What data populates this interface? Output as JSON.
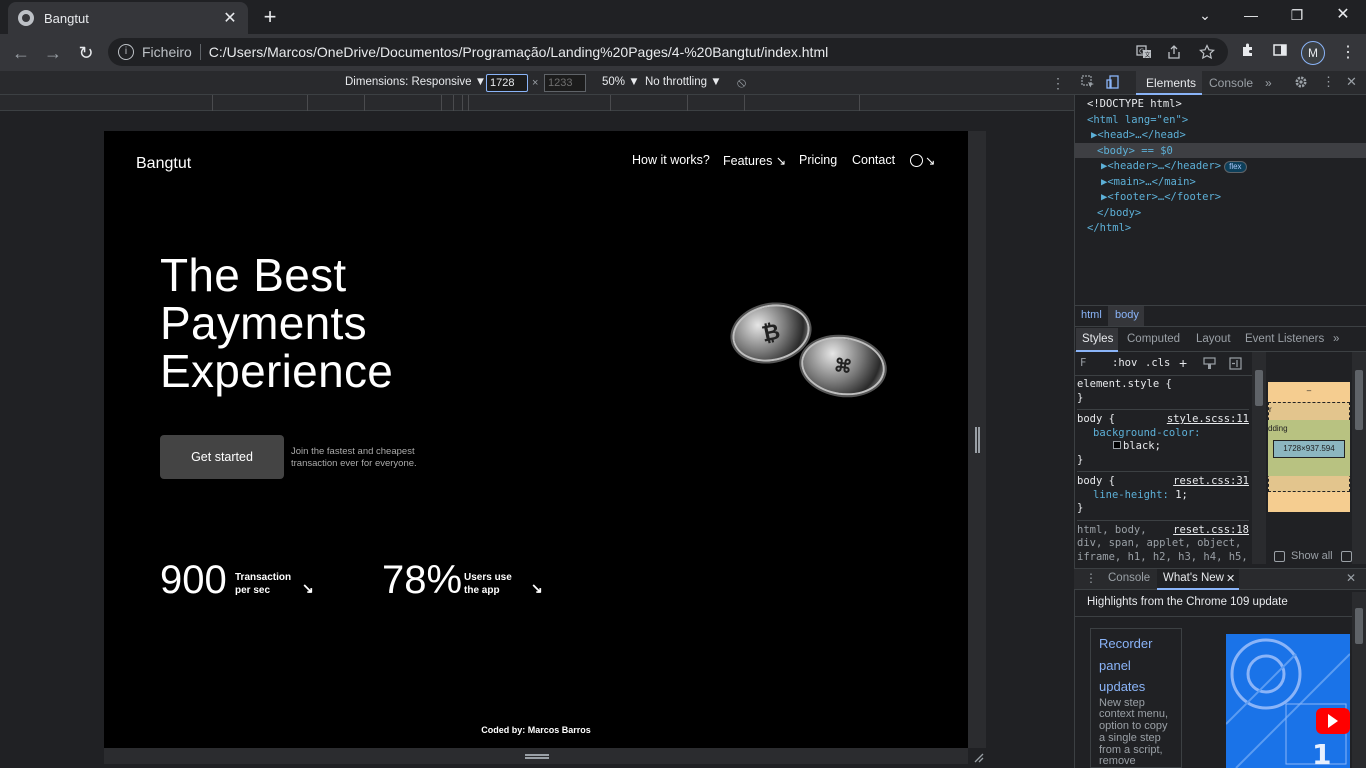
{
  "browser": {
    "tab_title": "Bangtut",
    "tab_close": "✕",
    "new_tab": "+",
    "window_controls": {
      "dropdown": "⌄",
      "minimize": "—",
      "restore": "❐",
      "close": "✕"
    },
    "nav": {
      "back": "←",
      "forward": "→",
      "reload": "↻"
    },
    "omnibox": {
      "info_icon": "i",
      "origin": "Ficheiro",
      "url": "C:/Users/Marcos/OneDrive/Documentos/Programação/Landing%20Pages/4-%20Bangtut/index.html"
    },
    "profile_initial": "M",
    "menu": "⋮"
  },
  "device_toolbar": {
    "dimensions_label": "Dimensions: Responsive ▼",
    "width": "1728",
    "times": "×",
    "height": "1233",
    "zoom": "50% ▼",
    "throttling": "No throttling ▼",
    "rotate_icon": "⦸",
    "more": "⋮"
  },
  "site": {
    "logo": "Bangtut",
    "nav": [
      "How it works?",
      "Features ↘",
      "Pricing",
      "Contact",
      "↘"
    ],
    "hero_lines": [
      "The Best",
      "Payments",
      "Experience"
    ],
    "cta_button": "Get started",
    "cta_text": "Join the fastest and cheapest transaction ever for everyone.",
    "stats": [
      {
        "number": "900",
        "label_1": "Transaction",
        "label_2": "per sec",
        "arrow": "↘"
      },
      {
        "number": "78%",
        "label_1": "Users use",
        "label_2": "the app",
        "arrow": "↘"
      }
    ],
    "coin_mark": "₿",
    "coin_mark_2": "⌘",
    "credit": "Coded by: Marcos Barros"
  },
  "devtools": {
    "tabs": [
      "Elements",
      "Console",
      "»"
    ],
    "dom": {
      "doctype": "<!DOCTYPE html>",
      "html_open": "<html lang=\"en\">",
      "head": "▶<head>…</head>",
      "body_open": "<body> == $0",
      "header": "▶<header>…</header>",
      "flex_badge": "flex",
      "main": "▶<main>…</main>",
      "footer": "▶<footer>…</footer>",
      "body_close": "</body>",
      "html_close": "</html>"
    },
    "breadcrumbs": [
      "html",
      "body"
    ],
    "styles_tabs": [
      "Styles",
      "Computed",
      "Layout",
      "Event Listeners",
      "»"
    ],
    "filter": {
      "placeholder": "F",
      "hov": ":hov",
      "cls": ".cls",
      "plus": "+"
    },
    "rules": [
      {
        "selector": "element.style {",
        "close": "}"
      },
      {
        "selector": "body {",
        "source": "style.scss:11",
        "prop": "background-color:",
        "value": "black;",
        "close": "}"
      },
      {
        "selector": "body {",
        "source": "reset.css:31",
        "prop": "line-height:",
        "value": "1;",
        "close": "}"
      },
      {
        "selector": "html, body,",
        "source": "reset.css:18",
        "extra": "div, span, applet, object, iframe, h1, h2, h3, h4, h5, h6, p, blockquote, pre, a,"
      }
    ],
    "box_model": {
      "content": "1728×937.594",
      "dash": "–",
      "border_label": "r",
      "padding_label": "dding"
    },
    "show_all": "Show all",
    "drawer_tabs": [
      "Console",
      "What's New"
    ],
    "drawer_close": "✕",
    "whats_new": {
      "heading": "Highlights from the Chrome 109 update",
      "link_lines": [
        "Recorder",
        "panel",
        "updates"
      ],
      "body": "New step context menu, option to copy a single step from a script, remove"
    }
  }
}
